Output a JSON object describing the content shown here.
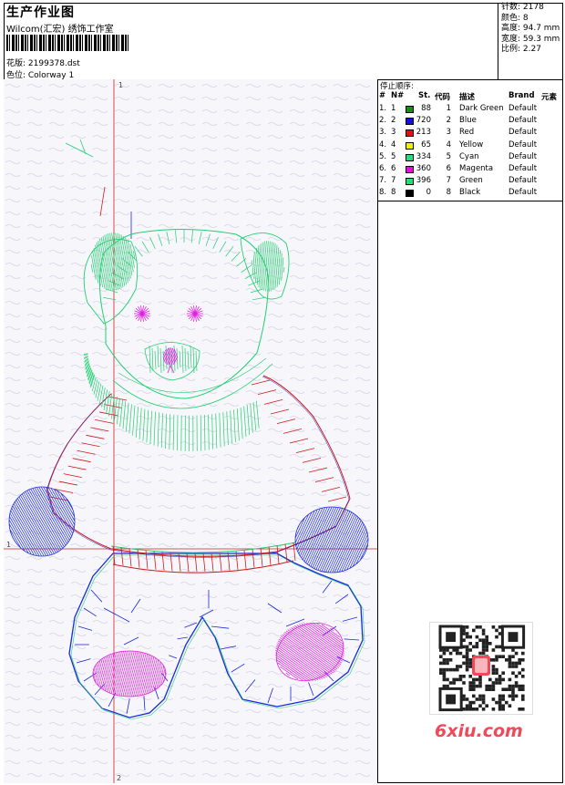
{
  "header": {
    "title": "生产作业图",
    "subtitle": "Wilcom(汇宏) 绣饰工作室",
    "design_label": "花版: 2199378.dst",
    "colorway_label": "色位: Colorway 1"
  },
  "info": [
    {
      "label": "针数",
      "value": "2178"
    },
    {
      "label": "颜色",
      "value": "8"
    },
    {
      "label": "高度",
      "value": "94.7 mm"
    },
    {
      "label": "宽度",
      "value": "59.3 mm"
    },
    {
      "label": "比例",
      "value": "2.27"
    }
  ],
  "info_text": [
    "针数: 2178",
    "颜色: 8",
    "高度: 94.7 mm",
    "宽度: 59.3 mm",
    "比例: 2.27"
  ],
  "legend": {
    "title": "停止顺序:",
    "headers": [
      "#",
      "N#",
      "St.",
      "代码",
      "描述",
      "Brand",
      "元素"
    ],
    "rows": [
      {
        "n": "1.",
        "seq": "1",
        "color": "#1a8c1a",
        "st": "88",
        "code": "1",
        "desc": "Dark Green",
        "brand": "Default"
      },
      {
        "n": "2.",
        "seq": "2",
        "color": "#1010e0",
        "st": "720",
        "code": "2",
        "desc": "Blue",
        "brand": "Default"
      },
      {
        "n": "3.",
        "seq": "3",
        "color": "#e01010",
        "st": "213",
        "code": "3",
        "desc": "Red",
        "brand": "Default"
      },
      {
        "n": "4.",
        "seq": "4",
        "color": "#f0f000",
        "st": "65",
        "code": "4",
        "desc": "Yellow",
        "brand": "Default"
      },
      {
        "n": "5.",
        "seq": "5",
        "color": "#20e080",
        "st": "334",
        "code": "5",
        "desc": "Cyan",
        "brand": "Default"
      },
      {
        "n": "6.",
        "seq": "6",
        "color": "#e010e0",
        "st": "360",
        "code": "6",
        "desc": "Magenta",
        "brand": "Default"
      },
      {
        "n": "7.",
        "seq": "7",
        "color": "#20e070",
        "st": "396",
        "code": "7",
        "desc": "Green",
        "brand": "Default"
      },
      {
        "n": "8.",
        "seq": "8",
        "color": "#000000",
        "st": "0",
        "code": "8",
        "desc": "Black",
        "brand": "Default"
      }
    ]
  },
  "axis_labels": {
    "top": "1",
    "bottom": "2",
    "left": "1"
  },
  "watermark": "6xiu.com",
  "colors": {
    "guide": "#d02020",
    "green": "#20d070",
    "blue": "#1a2adc",
    "red": "#d01818",
    "magenta": "#e020e0"
  }
}
